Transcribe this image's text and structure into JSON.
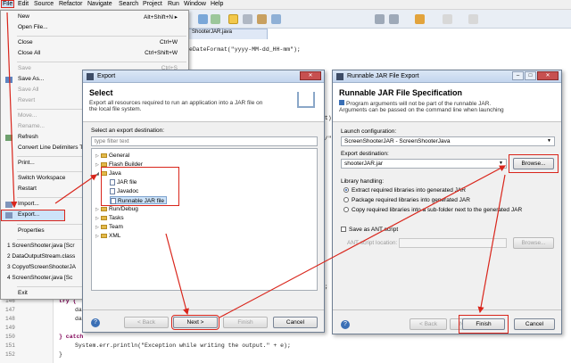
{
  "menubar": [
    "File",
    "Edit",
    "Source",
    "Refactor",
    "Navigate",
    "Search",
    "Project",
    "Run",
    "Window",
    "Help"
  ],
  "editor": {
    "tab": "ShooterJAR.java",
    "code_top": "eDateFormat(\"yyyy-MM-dd_HH-mm\");",
    "frag1": "ght)",
    "frag2": "op/\"",
    "frag3": "l;",
    "frag4": "t);",
    "line_numbers": [
      "146",
      "147",
      "148",
      "149",
      "150",
      "151",
      "152"
    ],
    "lines": {
      "try": "try {",
      "dat1": "dat",
      "dat2": "dat",
      "catch": "} catch",
      "println": "System.err.println(\"Exception while writing the output.\" + e);",
      "close": "}"
    }
  },
  "file_menu": {
    "new": {
      "label": "New",
      "accel": "Alt+Shift+N ▸"
    },
    "open_file": "Open File...",
    "close": {
      "label": "Close",
      "accel": "Ctrl+W"
    },
    "close_all": {
      "label": "Close All",
      "accel": "Ctrl+Shift+W"
    },
    "save": {
      "label": "Save",
      "accel": "Ctrl+S"
    },
    "save_as": "Save As...",
    "save_all": "Save All",
    "revert": "Revert",
    "move": "Move...",
    "rename": "Rename...",
    "refresh": "Refresh",
    "convert": "Convert Line Delimiters To",
    "print": "Print...",
    "switch_workspace": "Switch Workspace",
    "restart": "Restart",
    "import": "Import...",
    "export": "Export...",
    "properties": "Properties",
    "recent": [
      "1 ScreenShooter.java [Scr",
      "2 DataOutputStream.class",
      "3 CopyofScreenShooterJA",
      "4 ScreenShooter.java [Sc"
    ],
    "exit": "Exit"
  },
  "export_dialog": {
    "title": "Export",
    "heading": "Select",
    "description": "Export all resources required to run an application into a JAR file on the local file system.",
    "dest_label": "Select an export destination:",
    "filter_placeholder": "type filter text",
    "tree": {
      "general": "General",
      "flash_builder": "Flash Builder",
      "java": "Java",
      "jar_file": "JAR file",
      "javadoc": "Javadoc",
      "runnable_jar": "Runnable JAR file",
      "run_debug": "Run/Debug",
      "tasks": "Tasks",
      "team": "Team",
      "xml": "XML"
    },
    "help": "?",
    "back": "< Back",
    "next": "Next >",
    "finish": "Finish",
    "cancel": "Cancel"
  },
  "runnable_dialog": {
    "title": "Runnable JAR File Export",
    "heading": "Runnable JAR File Specification",
    "description_1": "Program arguments will not be part of the runnable JAR.",
    "description_2": "Arguments can be passed on the command line when launching",
    "launch_label": "Launch configuration:",
    "launch_value": "ScreenShooterJAR - ScreenShooterJava",
    "dest_label": "Export destination:",
    "dest_value": "shooterJAR.jar",
    "browse": "Browse...",
    "lib_label": "Library handling:",
    "lib_options": [
      "Extract required libraries into generated JAR",
      "Package required libraries into generated JAR",
      "Copy required libraries into a sub-folder next to the generated JAR"
    ],
    "save_ant": "Save as ANT script",
    "ant_label": "ANT script location:",
    "browse2": "Browse...",
    "help": "?",
    "back": "< Back",
    "next": "Next >",
    "finish": "Finish",
    "cancel": "Cancel"
  },
  "colors": {
    "annotation": "#d9251b",
    "highlight": "#cde3f9"
  }
}
